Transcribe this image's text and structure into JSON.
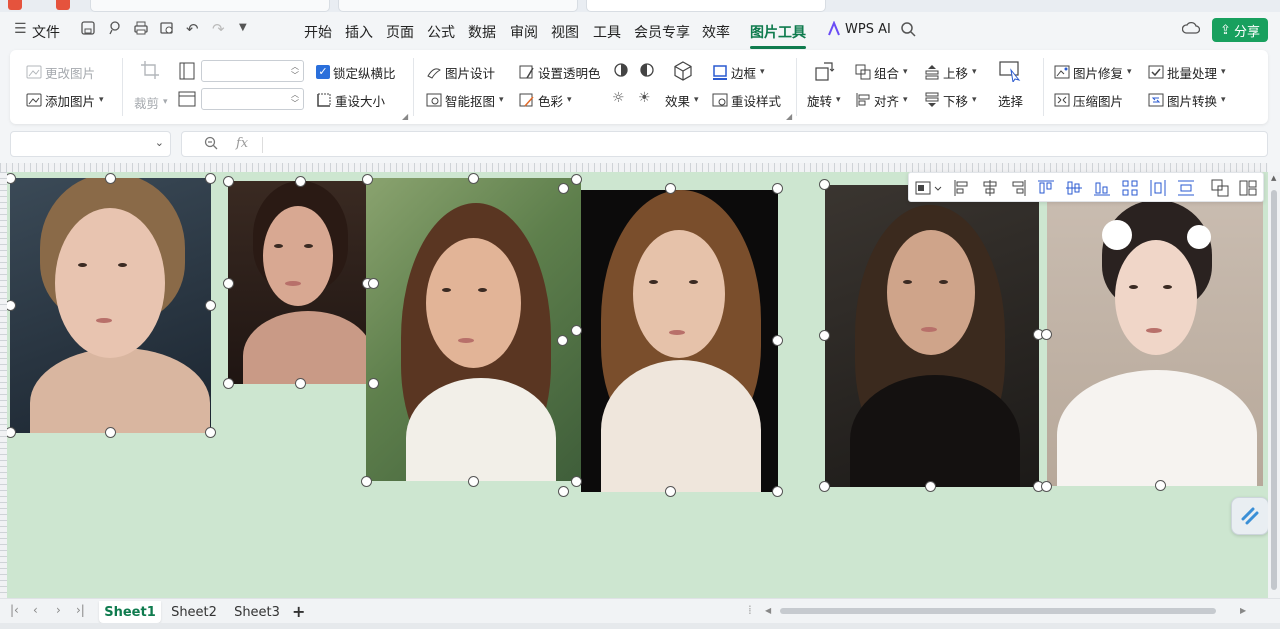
{
  "menu": {
    "file": "文件",
    "items": [
      "开始",
      "插入",
      "页面",
      "公式",
      "数据",
      "审阅",
      "视图",
      "工具",
      "会员专享",
      "效率",
      "图片工具"
    ],
    "active": "图片工具",
    "wps_ai": "WPS AI",
    "share": "分享"
  },
  "ribbon": {
    "change_picture": "更改图片",
    "add_picture": "添加图片",
    "crop": "裁剪",
    "lock_aspect": "锁定纵横比",
    "lock_aspect_checked": true,
    "resize": "重设大小",
    "picture_design": "图片设计",
    "smart_cutout": "智能抠图",
    "set_transparent": "设置透明色",
    "color": "色彩",
    "effects": "效果",
    "border": "边框",
    "reset_style": "重设样式",
    "rotate": "旋转",
    "group": "组合",
    "align": "对齐",
    "bring_forward": "上移",
    "send_backward": "下移",
    "select": "选择",
    "picture_repair": "图片修复",
    "compress_picture": "压缩图片",
    "batch_process": "批量处理",
    "picture_convert": "图片转换"
  },
  "formula_bar": {
    "name_box": "",
    "fx": "fx",
    "content": ""
  },
  "sheets": {
    "tabs": [
      "Sheet1",
      "Sheet2",
      "Sheet3"
    ],
    "active": "Sheet1"
  },
  "photos": [
    {
      "name": "photo-1",
      "bg": "#22303c",
      "skin": "#e8c4b0",
      "hair": "#8a6a48",
      "cloth": "#d9b6a0"
    },
    {
      "name": "photo-2",
      "bg": "#2b1e18",
      "skin": "#d8a892",
      "hair": "#2a1a14",
      "cloth": "#c99a86"
    },
    {
      "name": "photo-3",
      "bg": "#6f8f5a",
      "skin": "#e2b497",
      "hair": "#5a3622",
      "cloth": "#f2efe8"
    },
    {
      "name": "photo-4",
      "bg": "#0c0b0b",
      "skin": "#e6c2aa",
      "hair": "#7a4e2c",
      "cloth": "#efe6dc"
    },
    {
      "name": "photo-5",
      "bg": "#2a2622",
      "skin": "#cfa48a",
      "hair": "#3b2a1e",
      "cloth": "#141110"
    },
    {
      "name": "photo-6",
      "bg": "#c8b8aa",
      "skin": "#f0d6c8",
      "hair": "#2a2220",
      "cloth": "#f6f3f0"
    }
  ],
  "colors": {
    "accent": "#0f7b4e",
    "share_bg": "#18a05e",
    "sheet_bg": "#cde6d0"
  }
}
